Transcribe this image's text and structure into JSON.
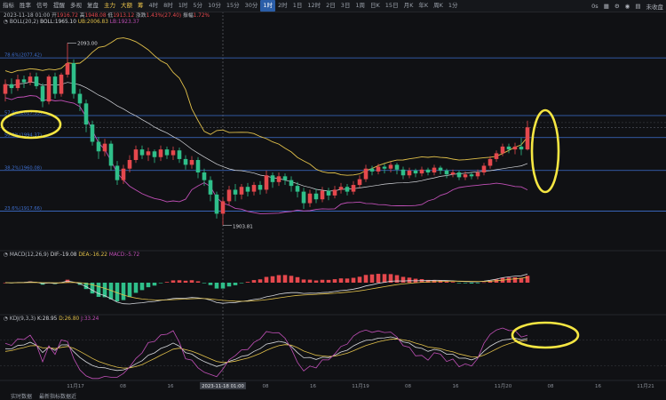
{
  "toolbar": {
    "left": [
      {
        "name": "indicator-tab",
        "label": "指标"
      },
      {
        "name": "winrate-tab",
        "label": "胜率"
      },
      {
        "name": "strategy-tab",
        "label": "信号"
      },
      {
        "name": "alert-tab",
        "label": "提醒"
      },
      {
        "name": "multi-tab",
        "label": "多视"
      },
      {
        "name": "replay-tab",
        "label": "复盘"
      }
    ],
    "tags": [
      {
        "name": "main-force-tab",
        "label": "主力"
      },
      {
        "name": "big-order-tab",
        "label": "大额"
      },
      {
        "name": "sentiment-tab",
        "label": "筹"
      }
    ],
    "periods": [
      "4时",
      "8时",
      "1时",
      "5分",
      "10分",
      "15分",
      "30分",
      "1时",
      "2时",
      "1日",
      "12时",
      "2日",
      "3日",
      "1周",
      "日K",
      "15日",
      "月K",
      "年K",
      "周K",
      "1分"
    ],
    "active_period_index": 7,
    "right_time": "0s",
    "right_label": "未收盘"
  },
  "info": {
    "date": "2023-11-18 01:00",
    "open_label": "开",
    "open": "1916.72",
    "high_label": "高",
    "high": "1948.08",
    "low_label": "低",
    "low": "1913.12",
    "change_label": "涨跌",
    "change": "1.43%(27.40)",
    "amp_label": "振幅",
    "amp": "1.72%"
  },
  "boll": {
    "title": "BOLL(20,2)",
    "mid": "BOLL:1965.10",
    "ub": "UB:2006.83",
    "lb": "LB:1923.37"
  },
  "fib_levels": [
    {
      "label": "78.6%(2077.42)",
      "price": 2077.42
    },
    {
      "label": "57.9%(2017.33)",
      "price": 2017.33
    },
    {
      "label": "50.0%(1994.37)",
      "price": 1994.37
    },
    {
      "label": "38.2%(1960.08)",
      "price": 1960.08
    },
    {
      "label": "23.6%(1917.66)",
      "price": 1917.66
    }
  ],
  "annotations": {
    "high_mark": "2093.00",
    "low_mark": "1903.81"
  },
  "macd": {
    "title": "MACD(12,26,9)",
    "dif": "DIF:-19.08",
    "dea": "DEA:-16.22",
    "macd": "MACD:-5.72"
  },
  "kdj": {
    "title": "KDJ(9,3,3)",
    "k": "K:28.95",
    "d": "D:26.80",
    "j": "J:33.24"
  },
  "x_labels": [
    "11月17",
    "08",
    "16",
    "11月18",
    "08",
    "16",
    "11月19",
    "08",
    "16",
    "11月20",
    "08",
    "16",
    "11月21"
  ],
  "crosshair_time": "2023-11-18 01:00",
  "footer": {
    "text1": "实时数据",
    "text2": "最新指标数据近"
  },
  "colors": {
    "up": "#e5484d",
    "down": "#2fbf8a",
    "boll_mid": "#e2c14a",
    "boll_band": "#c04fb6",
    "fib": "#3d6fcf",
    "highlight": "#f5e642"
  },
  "chart_data": {
    "type": "candlestick",
    "price_range": [
      1895,
      2110
    ],
    "candles": [
      [
        2040,
        2050,
        2032,
        2055
      ],
      [
        2050,
        2046,
        2040,
        2056
      ],
      [
        2046,
        2055,
        2043,
        2060
      ],
      [
        2055,
        2052,
        2046,
        2059
      ],
      [
        2052,
        2058,
        2049,
        2062
      ],
      [
        2058,
        2048,
        2045,
        2062
      ],
      [
        2048,
        2032,
        2026,
        2051
      ],
      [
        2032,
        2058,
        2029,
        2060
      ],
      [
        2058,
        2040,
        2035,
        2062
      ],
      [
        2040,
        2060,
        2037,
        2062
      ],
      [
        2060,
        2072,
        2057,
        2093
      ],
      [
        2072,
        2040,
        2035,
        2076
      ],
      [
        2040,
        2030,
        2022,
        2045
      ],
      [
        2030,
        2008,
        2000,
        2034
      ],
      [
        2008,
        1990,
        1986,
        2012
      ],
      [
        1990,
        1980,
        1972,
        1995
      ],
      [
        1980,
        1988,
        1975,
        1993
      ],
      [
        1988,
        1965,
        1960,
        1991
      ],
      [
        1965,
        1950,
        1945,
        1970
      ],
      [
        1950,
        1962,
        1946,
        1966
      ],
      [
        1962,
        1971,
        1958,
        1976
      ],
      [
        1971,
        1982,
        1968,
        1986
      ],
      [
        1982,
        1976,
        1972,
        1986
      ],
      [
        1976,
        1980,
        1970,
        1984
      ],
      [
        1980,
        1974,
        1968,
        1982
      ],
      [
        1974,
        1982,
        1970,
        1986
      ],
      [
        1982,
        1976,
        1972,
        1985
      ],
      [
        1976,
        1981,
        1971,
        1985
      ],
      [
        1981,
        1972,
        1968,
        1984
      ],
      [
        1972,
        1966,
        1961,
        1976
      ],
      [
        1966,
        1971,
        1962,
        1975
      ],
      [
        1971,
        1958,
        1952,
        1974
      ],
      [
        1958,
        1950,
        1944,
        1962
      ],
      [
        1950,
        1935,
        1928,
        1954
      ],
      [
        1935,
        1915,
        1910,
        1938
      ],
      [
        1915,
        1928,
        1903,
        1932
      ],
      [
        1928,
        1940,
        1924,
        1944
      ],
      [
        1940,
        1935,
        1928,
        1946
      ],
      [
        1935,
        1943,
        1930,
        1946
      ],
      [
        1943,
        1938,
        1933,
        1947
      ],
      [
        1938,
        1945,
        1934,
        1948
      ],
      [
        1945,
        1940,
        1935,
        1949
      ],
      [
        1940,
        1955,
        1936,
        1960
      ],
      [
        1955,
        1948,
        1942,
        1958
      ],
      [
        1948,
        1954,
        1944,
        1958
      ],
      [
        1954,
        1950,
        1945,
        1957
      ],
      [
        1950,
        1944,
        1938,
        1954
      ],
      [
        1944,
        1938,
        1932,
        1948
      ],
      [
        1938,
        1926,
        1920,
        1942
      ],
      [
        1926,
        1936,
        1922,
        1940
      ],
      [
        1936,
        1930,
        1926,
        1941
      ],
      [
        1930,
        1939,
        1927,
        1943
      ],
      [
        1939,
        1934,
        1929,
        1942
      ],
      [
        1934,
        1940,
        1931,
        1944
      ],
      [
        1940,
        1943,
        1936,
        1947
      ],
      [
        1943,
        1938,
        1934,
        1946
      ],
      [
        1938,
        1945,
        1935,
        1949
      ],
      [
        1945,
        1951,
        1942,
        1955
      ],
      [
        1951,
        1962,
        1948,
        1966
      ],
      [
        1962,
        1959,
        1955,
        1965
      ],
      [
        1959,
        1964,
        1956,
        1967
      ],
      [
        1964,
        1962,
        1957,
        1967
      ],
      [
        1962,
        1966,
        1958,
        1969
      ],
      [
        1966,
        1961,
        1956,
        1968
      ],
      [
        1961,
        1955,
        1951,
        1964
      ],
      [
        1955,
        1960,
        1952,
        1963
      ],
      [
        1960,
        1957,
        1953,
        1962
      ],
      [
        1957,
        1961,
        1954,
        1964
      ],
      [
        1961,
        1958,
        1955,
        1963
      ],
      [
        1958,
        1963,
        1955,
        1966
      ],
      [
        1963,
        1960,
        1956,
        1965
      ],
      [
        1960,
        1956,
        1952,
        1962
      ],
      [
        1956,
        1958,
        1953,
        1961
      ],
      [
        1958,
        1953,
        1950,
        1960
      ],
      [
        1953,
        1956,
        1950,
        1959
      ],
      [
        1956,
        1954,
        1951,
        1958
      ],
      [
        1954,
        1958,
        1951,
        1961
      ],
      [
        1958,
        1965,
        1955,
        1968
      ],
      [
        1965,
        1972,
        1962,
        1975
      ],
      [
        1972,
        1978,
        1969,
        1981
      ],
      [
        1978,
        1985,
        1975,
        1988
      ],
      [
        1985,
        1982,
        1978,
        1988
      ],
      [
        1982,
        1985,
        1977,
        1989
      ],
      [
        1985,
        1982,
        1976,
        1994
      ],
      [
        1982,
        2005,
        1981,
        2012
      ]
    ]
  }
}
